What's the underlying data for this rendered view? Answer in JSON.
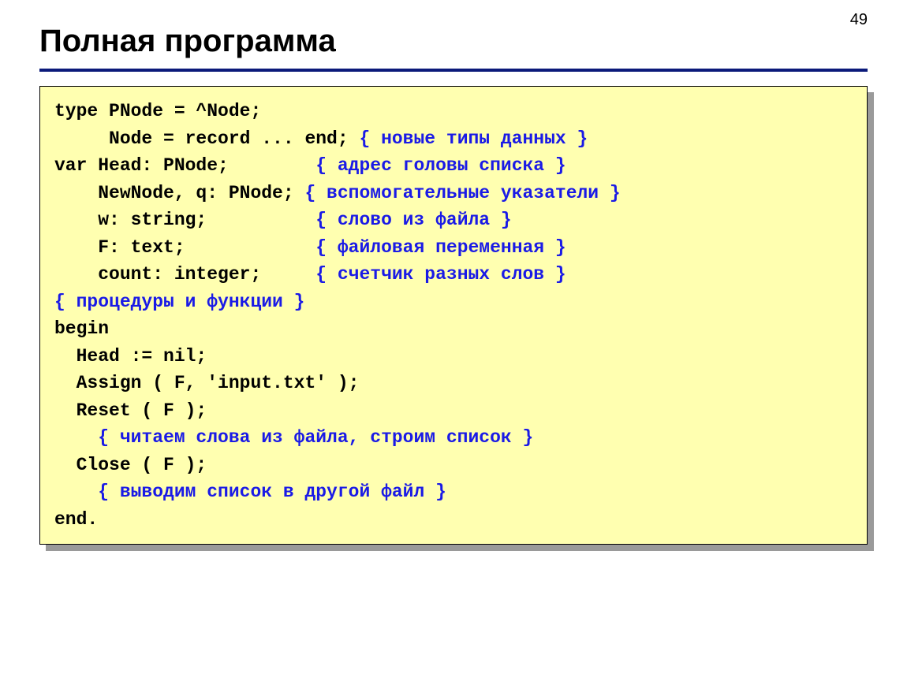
{
  "page_number": "49",
  "title": "Полная программа",
  "code": {
    "l1": "type PNode = ^Node;",
    "l2a": "     Node = record ... end; ",
    "l2c": "{ новые типы данных }",
    "l3a": "var Head: PNode;        ",
    "l3c": "{ адрес головы списка }",
    "l4a": "    NewNode, q: PNode; ",
    "l4c": "{ вспомогательные указатели }",
    "l5a": "    w: string;          ",
    "l5c": "{ слово из файла }",
    "l6a": "    F: text;            ",
    "l6c": "{ файловая переменная }",
    "l7a": "    count: integer;     ",
    "l7c": "{ счетчик разных слов }",
    "l8c": "{ процедуры и функции }",
    "l9": "begin",
    "l10": "  Head := nil;",
    "l11": "  Assign ( F, 'input.txt' );",
    "l12": "  Reset ( F );",
    "l13c": "    { читаем слова из файла, строим список }",
    "l14": "  Close ( F );",
    "l15c": "    { выводим список в другой файл }",
    "l16": "end."
  }
}
